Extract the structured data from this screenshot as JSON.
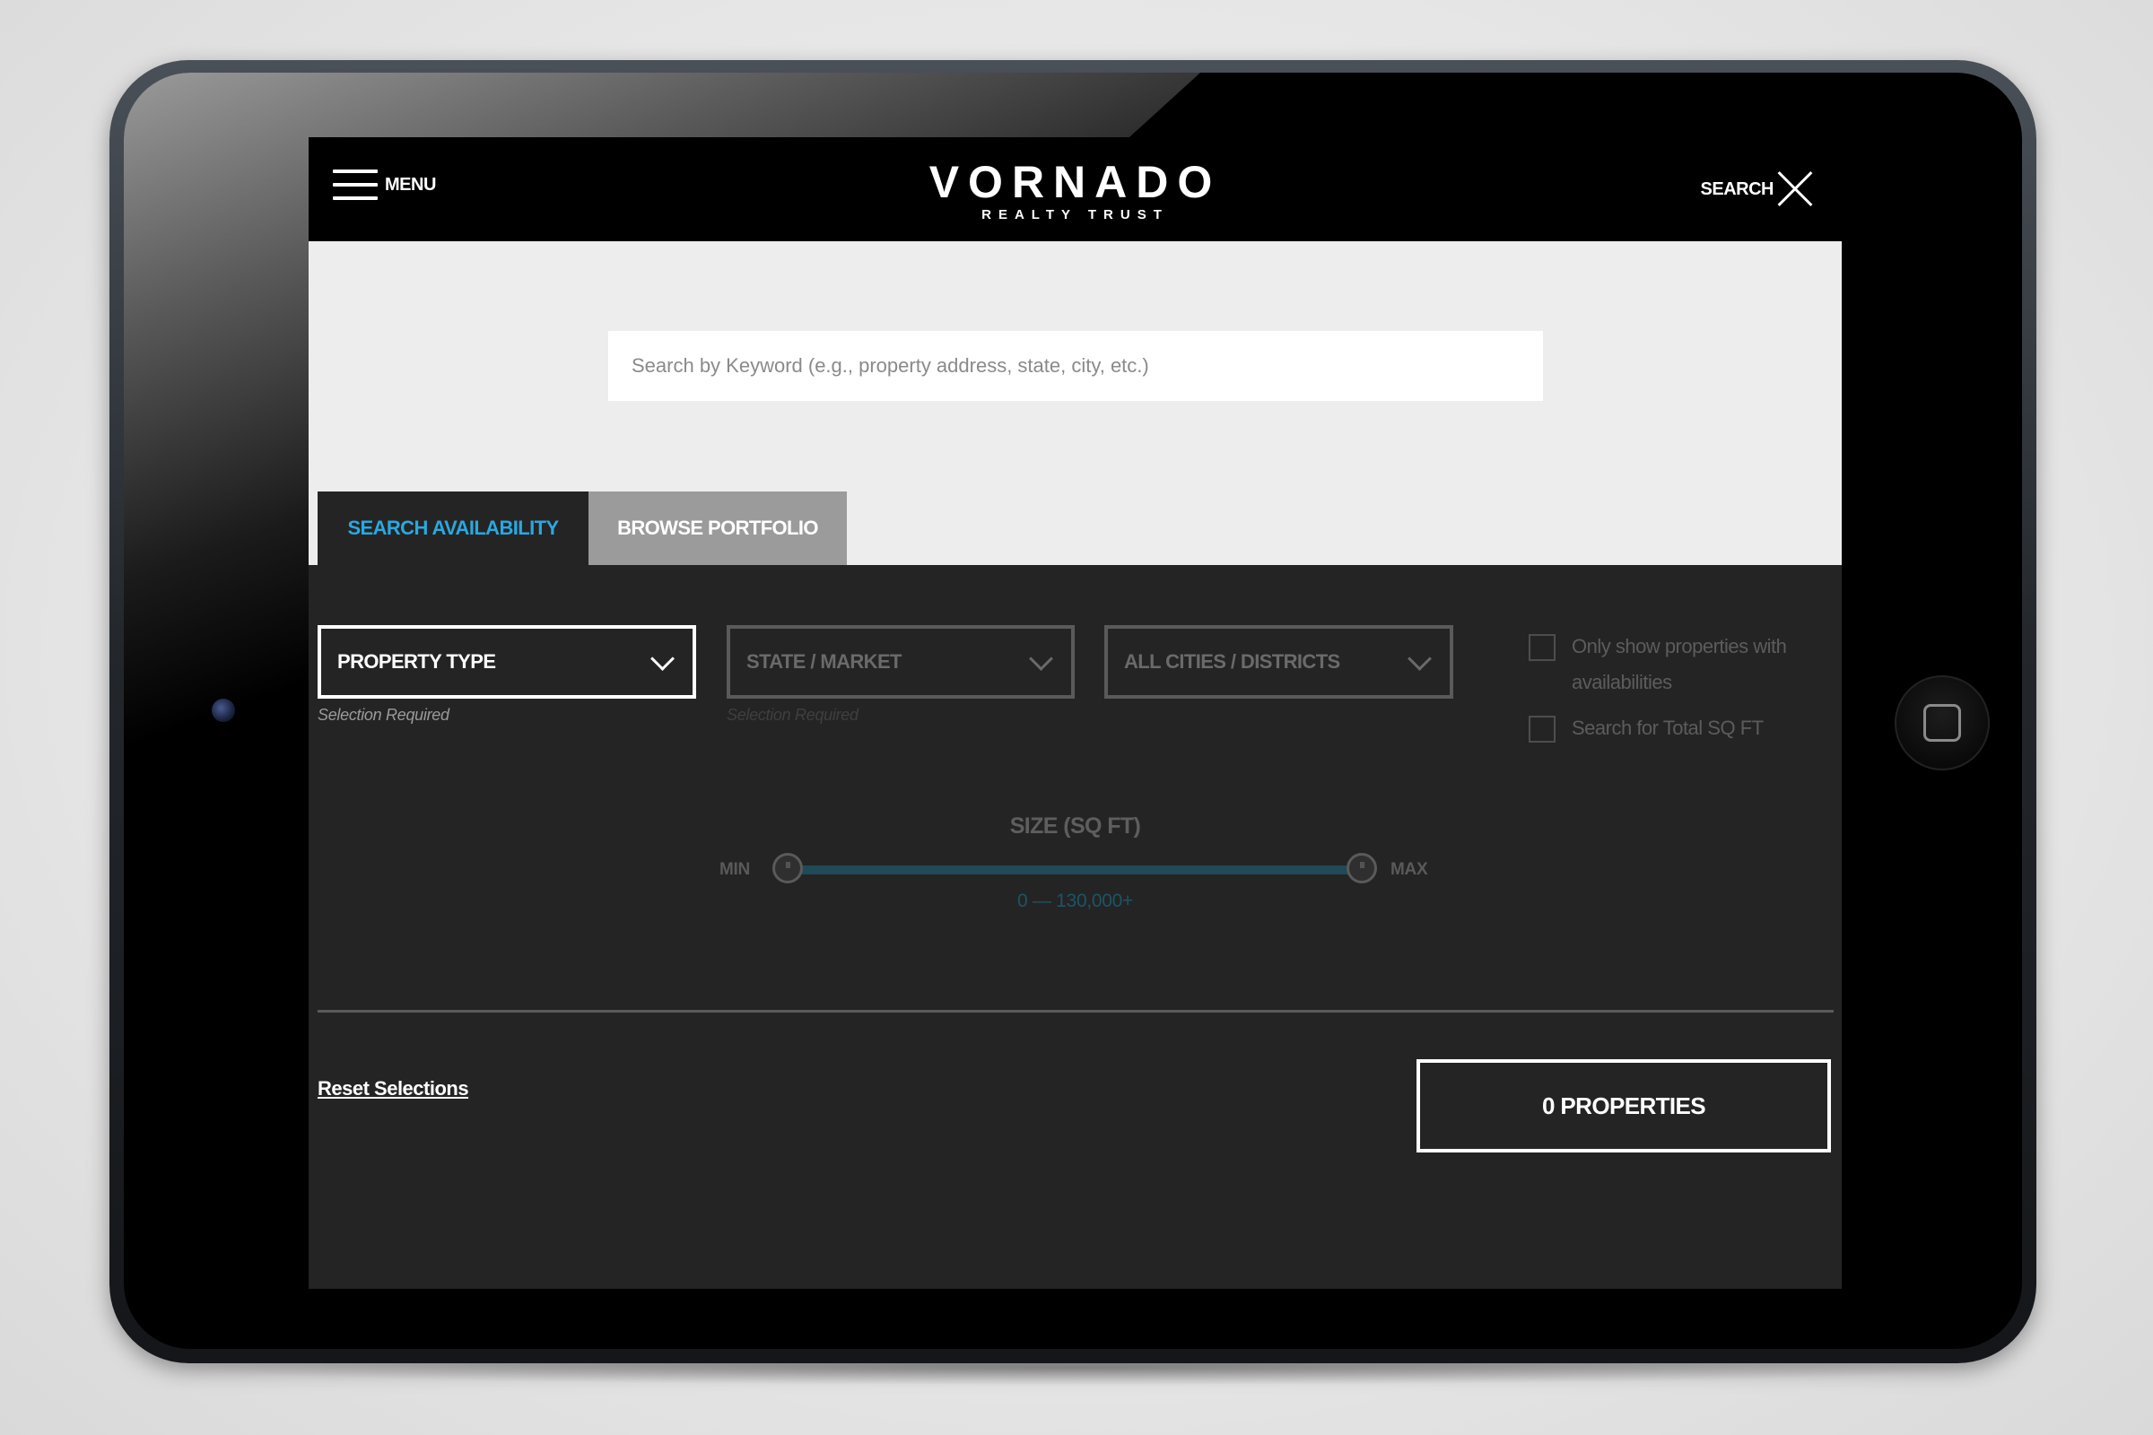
{
  "header": {
    "menu_label": "MENU",
    "logo_main": "VORNADO",
    "logo_sub": "REALTY TRUST",
    "search_label": "SEARCH"
  },
  "search": {
    "placeholder": "Search by Keyword (e.g., property address, state, city, etc.)"
  },
  "tabs": [
    {
      "label": "SEARCH AVAILABILITY",
      "active": true
    },
    {
      "label": "BROWSE PORTFOLIO",
      "active": false
    }
  ],
  "filters": {
    "property_type": {
      "label": "PROPERTY TYPE",
      "hint": "Selection Required"
    },
    "state_market": {
      "label": "STATE / MARKET",
      "hint": "Selection Required"
    },
    "cities": {
      "label": "ALL CITIES / DISTRICTS"
    }
  },
  "checkboxes": [
    {
      "label": "Only show properties with availabilities",
      "checked": false
    },
    {
      "label": "Search for Total SQ FT",
      "checked": false
    }
  ],
  "size": {
    "title": "SIZE (SQ FT)",
    "min_label": "MIN",
    "max_label": "MAX",
    "range_text": "0 — 130,000+"
  },
  "footer": {
    "reset_label": "Reset Selections",
    "results_label": "0 PROPERTIES"
  },
  "colors": {
    "accent": "#2aa8e0",
    "screen_bg": "#242424",
    "header_bg": "#000000"
  }
}
